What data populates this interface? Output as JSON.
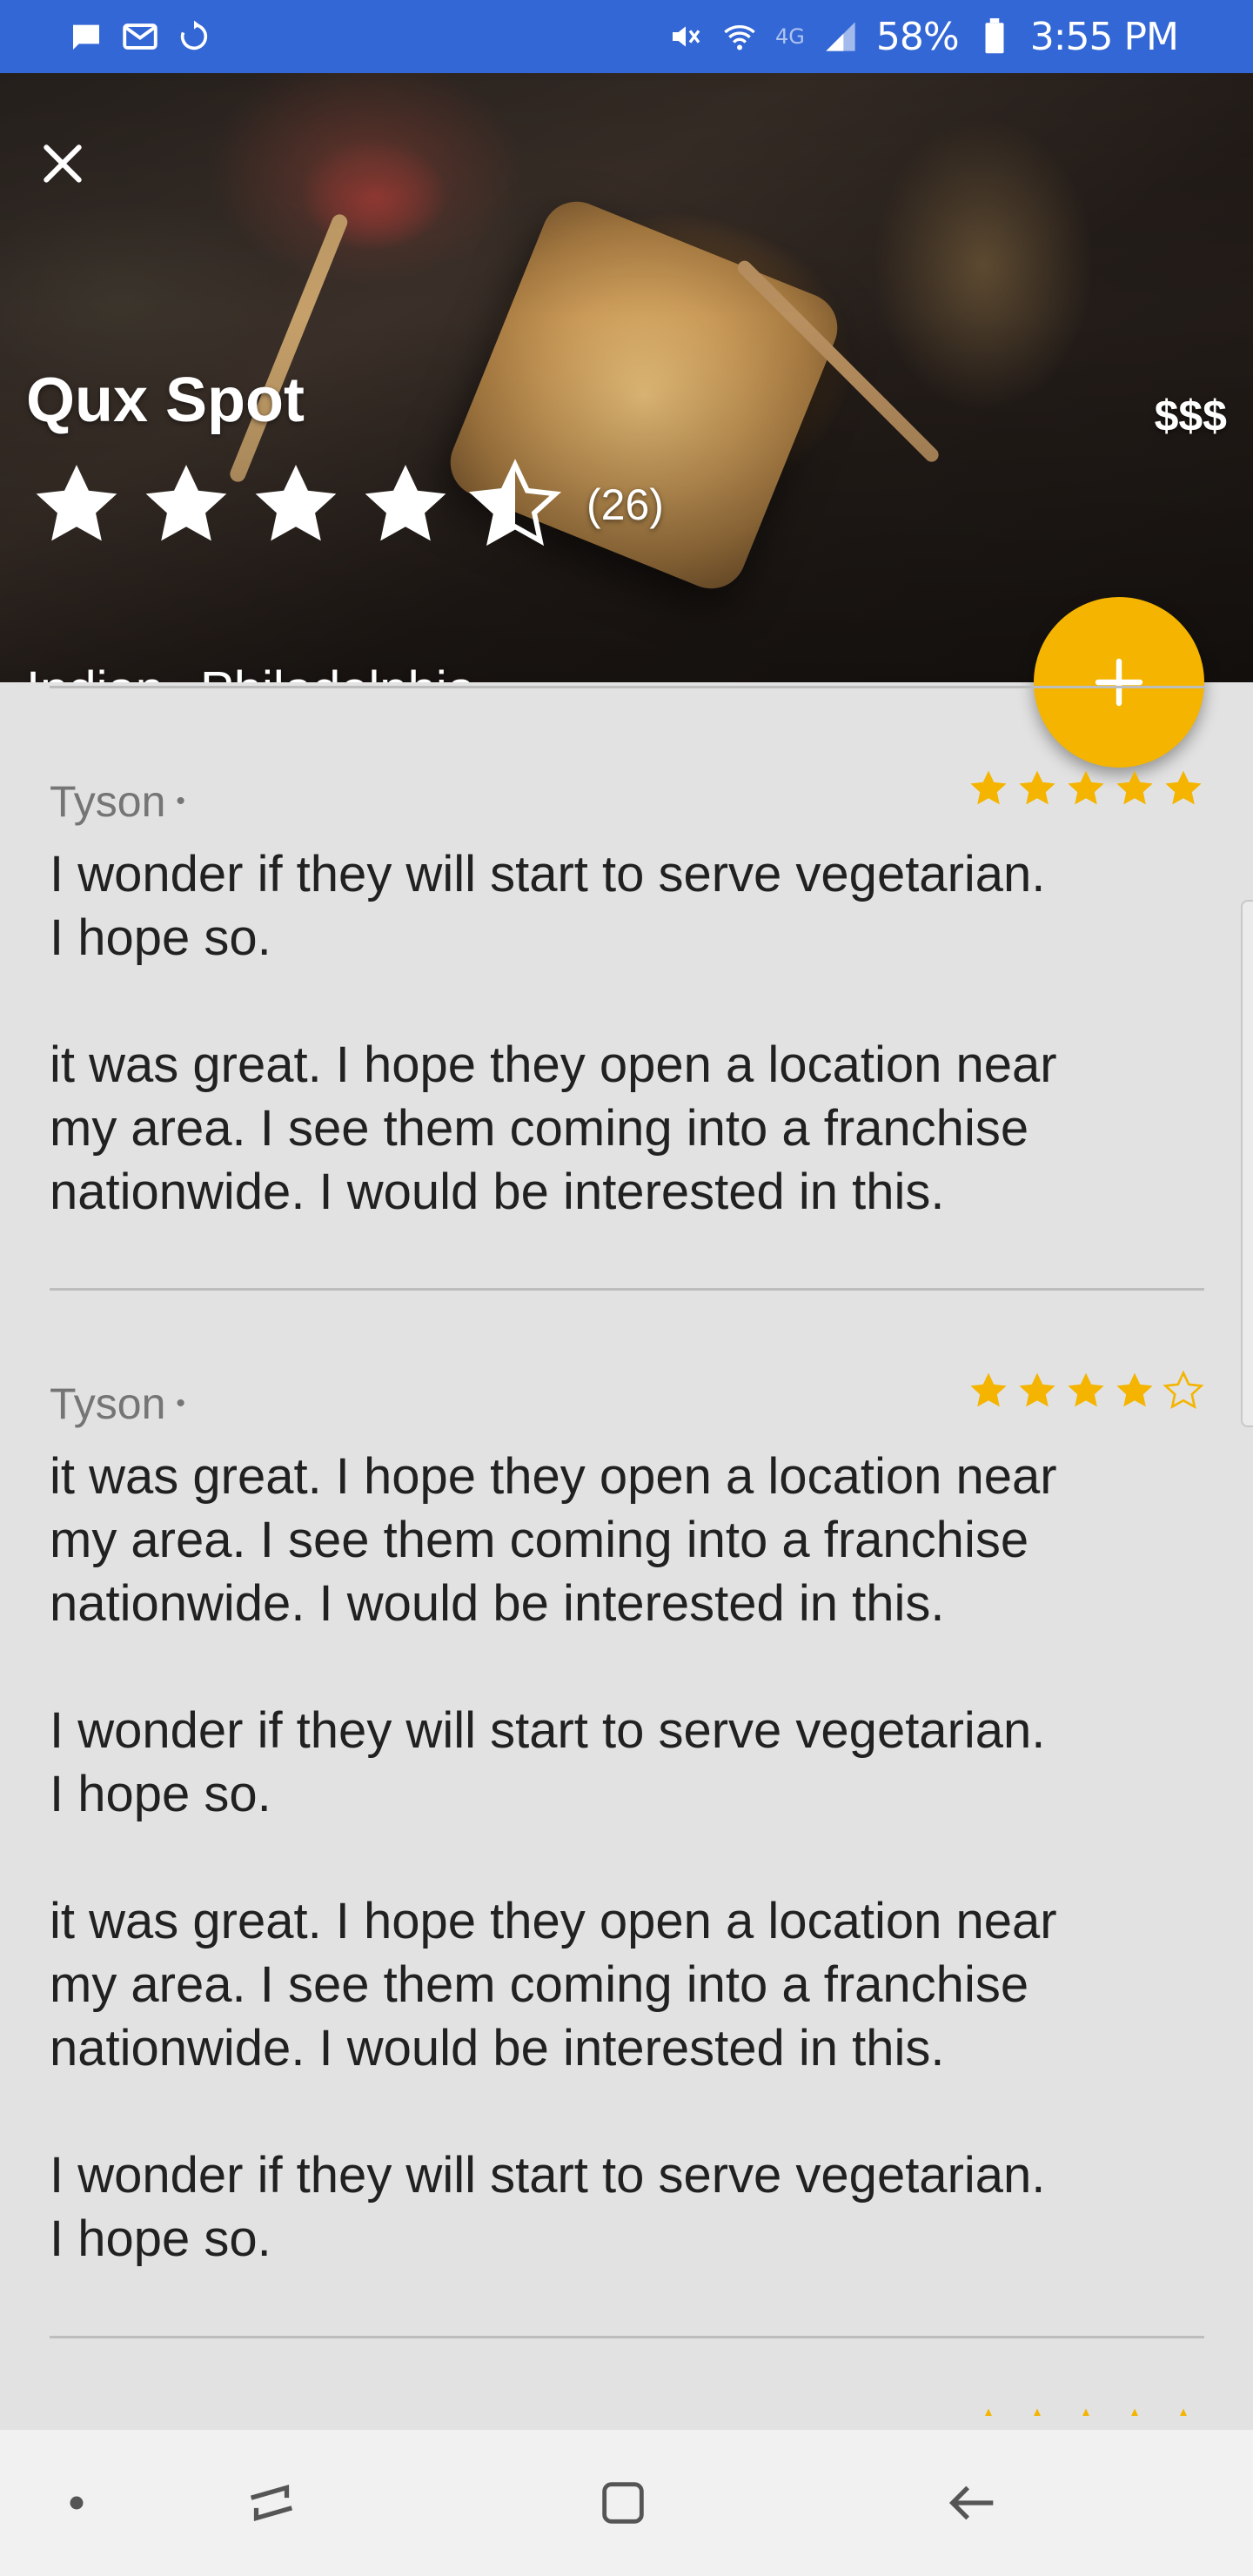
{
  "status_bar": {
    "time": "3:55 PM",
    "battery": "58%",
    "network": "4G",
    "icons_left": [
      "message-icon",
      "gmail-icon",
      "sync-icon"
    ],
    "icons_right": [
      "mute-icon",
      "wifi-icon",
      "signal-icon",
      "battery-icon"
    ]
  },
  "restaurant": {
    "name": "Qux Spot",
    "price": "$$$",
    "rating": 4.5,
    "review_count": "(26)",
    "cuisine": "Indian",
    "separator": "•",
    "city": "Philadelphia"
  },
  "colors": {
    "status_bar": "#3367d6",
    "accent": "#f4b400",
    "background": "#e2e2e2"
  },
  "reviews": [
    {
      "author": "Tyson",
      "bullet": "•",
      "rating": 5,
      "text": "I wonder if they will start to serve vegetarian.\nI hope so.\n\nit was great. I hope they open a location near\nmy area. I see them coming into a franchise\nnationwide. I would be interested in this."
    },
    {
      "author": "Tyson",
      "bullet": "•",
      "rating": 4,
      "text": "it was great. I hope they open a location near\nmy area. I see them coming into a franchise\nnationwide. I would be interested in this.\n\nI wonder if they will start to serve vegetarian.\nI hope so.\n\nit was great. I hope they open a location near\nmy area. I see them coming into a franchise\nnationwide. I would be interested in this.\n\nI wonder if they will start to serve vegetarian.\nI hope so."
    }
  ],
  "nav_bar": {
    "items": [
      "dot-icon",
      "recents-icon",
      "home-icon",
      "back-icon"
    ]
  }
}
